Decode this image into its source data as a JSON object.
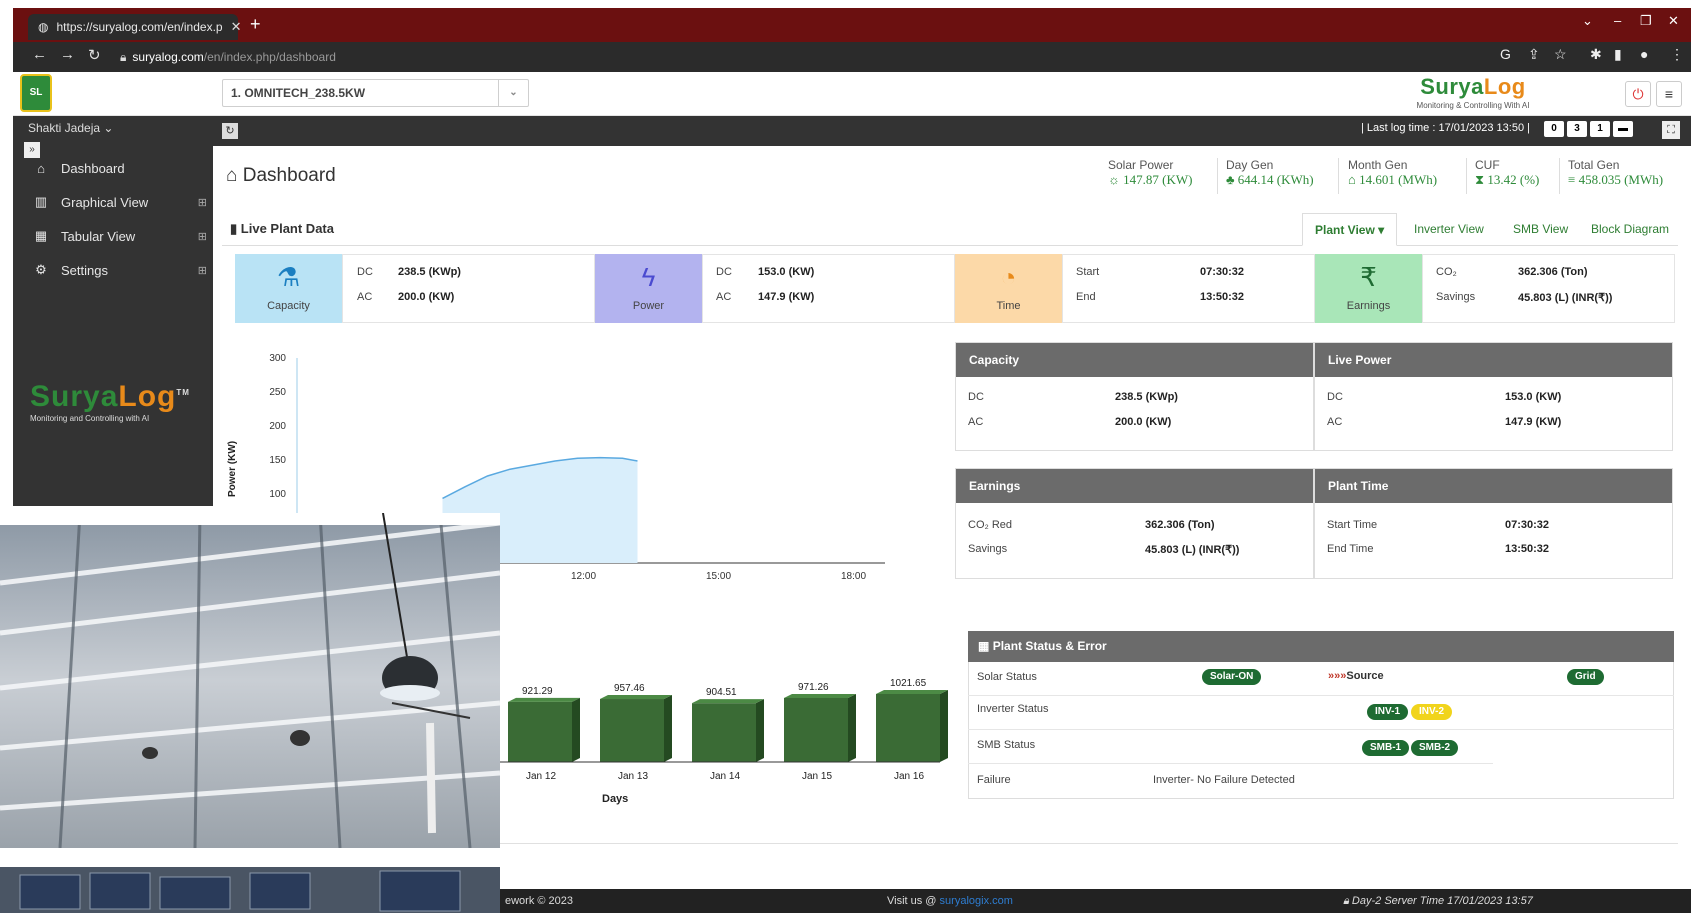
{
  "browser": {
    "tab_title": "https://suryalog.com/en/index.p",
    "url_host": "suryalog.com",
    "url_path": "/en/index.php/dashboard"
  },
  "header": {
    "plant_select": "1. OMNITECH_238.5KW",
    "brand_name_a": "Surya",
    "brand_name_b": "Log",
    "brand_tagline": "Monitoring & Controlling With AI"
  },
  "sidebar": {
    "user": "Shakti Jadeja",
    "items": [
      {
        "label": "Dashboard",
        "icon": "home-icon"
      },
      {
        "label": "Graphical View",
        "icon": "bar-chart-icon"
      },
      {
        "label": "Tabular View",
        "icon": "table-icon"
      },
      {
        "label": "Settings",
        "icon": "gears-icon"
      }
    ],
    "logo_a": "Surya",
    "logo_b": "Log",
    "logo_tagline": "Monitoring and Controlling with AI",
    "logo_tm": "TM"
  },
  "toolbar": {
    "last_log": "| Last log time : 17/01/2023 13:50 |",
    "counters": [
      "0",
      "3",
      "1"
    ]
  },
  "page": {
    "title": "Dashboard"
  },
  "kpis": [
    {
      "label": "Solar Power",
      "value": "147.87 (KW)",
      "icon": "sun-icon"
    },
    {
      "label": "Day Gen",
      "value": "644.14 (KWh)",
      "icon": "tree-icon"
    },
    {
      "label": "Month Gen",
      "value": "14.601 (MWh)",
      "icon": "bank-icon"
    },
    {
      "label": "CUF",
      "value": "13.42 (%)",
      "icon": "hourglass-icon"
    },
    {
      "label": "Total Gen",
      "value": "458.035 (MWh)",
      "icon": "database-icon"
    }
  ],
  "live": {
    "title": "Live Plant Data",
    "tabs": [
      "Plant View",
      "Inverter View",
      "SMB View",
      "Block Diagram"
    ]
  },
  "cards": {
    "capacity": {
      "label": "Capacity",
      "dc_key": "DC",
      "dc": "238.5 (KWp)",
      "ac_key": "AC",
      "ac": "200.0 (KW)"
    },
    "power": {
      "label": "Power",
      "dc_key": "DC",
      "dc": "153.0 (KW)",
      "ac_key": "AC",
      "ac": "147.9 (KW)"
    },
    "time": {
      "label": "Time",
      "start_key": "Start",
      "start": "07:30:32",
      "end_key": "End",
      "end": "13:50:32"
    },
    "earnings": {
      "label": "Earnings",
      "co2_key": "CO₂",
      "co2": "362.306 (Ton)",
      "sav_key": "Savings",
      "savings": "45.803 (L) (INR(₹))"
    }
  },
  "chart_data": [
    {
      "type": "area",
      "ylabel": "Power (KW)",
      "yticks": [
        "300",
        "250",
        "200",
        "150",
        "100"
      ],
      "xticks": [
        "12:00",
        "15:00",
        "18:00"
      ],
      "ylim": [
        0,
        300
      ],
      "x": [
        "09:30",
        "10:00",
        "10:30",
        "11:00",
        "11:30",
        "12:00",
        "12:30",
        "13:00",
        "13:30",
        "13:50"
      ],
      "values": [
        95,
        112,
        128,
        138,
        144,
        150,
        154,
        155,
        154,
        150
      ]
    },
    {
      "type": "bar",
      "xlabel": "Days",
      "categories": [
        "Jan 12",
        "Jan 13",
        "Jan 14",
        "Jan 15",
        "Jan 16"
      ],
      "values": [
        921.29,
        957.46,
        904.51,
        971.26,
        1021.65
      ],
      "value_labels": [
        "921.29",
        "957.46",
        "904.51",
        "971.26",
        "1021.65"
      ],
      "color": "#3a6b35"
    }
  ],
  "info": {
    "capacity": {
      "title": "Capacity",
      "dc_key": "DC",
      "dc": "238.5 (KWp)",
      "ac_key": "AC",
      "ac": "200.0 (KW)"
    },
    "live_power": {
      "title": "Live Power",
      "dc_key": "DC",
      "dc": "153.0 (KW)",
      "ac_key": "AC",
      "ac": "147.9 (KW)"
    },
    "earnings": {
      "title": "Earnings",
      "co2_key": "CO₂ Red",
      "co2": "362.306 (Ton)",
      "sav_key": "Savings",
      "savings": "45.803 (L) (INR(₹))"
    },
    "plant_time": {
      "title": "Plant Time",
      "start_key": "Start Time",
      "start": "07:30:32",
      "end_key": "End Time",
      "end": "13:50:32"
    }
  },
  "status": {
    "title": "Plant Status & Error",
    "solar_label": "Solar Status",
    "solar_pill": "Solar-ON",
    "source_label": "Source",
    "grid_pill": "Grid",
    "inverter_label": "Inverter Status",
    "inv_pills": [
      "INV-1",
      "INV-2"
    ],
    "smb_label": "SMB Status",
    "smb_pills": [
      "SMB-1",
      "SMB-2"
    ],
    "failure_label": "Failure",
    "failure_text": "Inverter- No Failure Detected"
  },
  "footer": {
    "left": "ework © 2023",
    "visit": "Visit us @",
    "link": "suryalogix.com",
    "right": "Day-2  Server Time 17/01/2023 13:57"
  },
  "colors": {
    "accent_green": "#2e8b3a",
    "brand_orange": "#e88a1a",
    "header_gray": "#6b6b6b"
  }
}
